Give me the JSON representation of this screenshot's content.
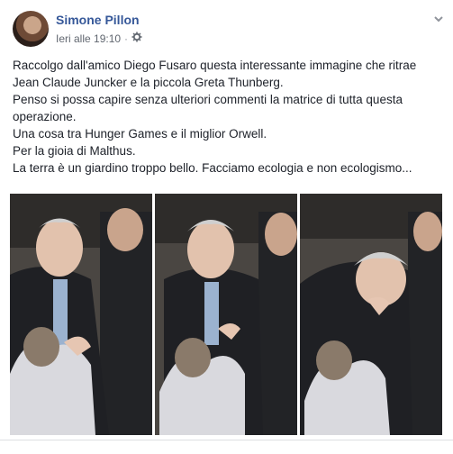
{
  "post": {
    "author": "Simone Pillon",
    "timestamp": "Ieri alle 19:10",
    "separator": "·",
    "privacy_icon": "gear-icon",
    "menu_icon": "chevron-down-icon",
    "paragraphs": [
      "Raccolgo dall'amico Diego Fusaro questa interessante immagine che ritrae Jean Claude Juncker e la piccola Greta Thunberg.",
      "Penso si possa capire senza ulteriori commenti la matrice di tutta questa operazione.",
      "Una cosa tra Hunger Games e il miglior Orwell.",
      "Per la gioia di Malthus.",
      "La terra è un giardino troppo bello. Facciamo ecologia e non ecologismo..."
    ]
  },
  "colors": {
    "author": "#365899",
    "meta": "#616770",
    "text": "#1d2129"
  }
}
